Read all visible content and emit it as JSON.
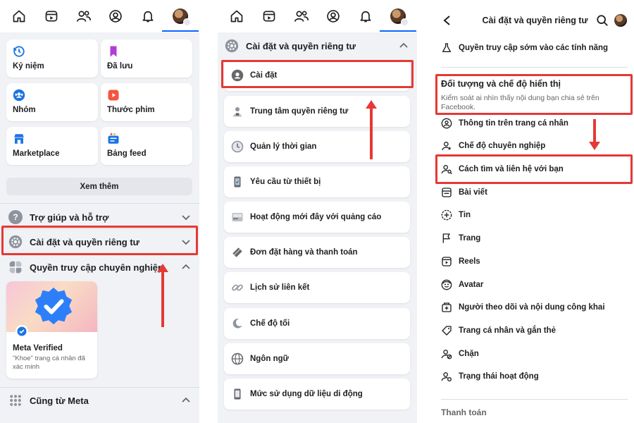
{
  "nav_tabs": [
    "home-icon",
    "video-icon",
    "friends-icon",
    "profile-icon",
    "bell-icon",
    "avatar-menu"
  ],
  "panel1": {
    "shortcuts": [
      {
        "label": "Kỷ niệm",
        "icon": "memories-icon"
      },
      {
        "label": "Đã lưu",
        "icon": "saved-icon"
      },
      {
        "label": "Nhóm",
        "icon": "groups-icon"
      },
      {
        "label": "Thước phim",
        "icon": "reels-icon"
      },
      {
        "label": "Marketplace",
        "icon": "marketplace-icon"
      },
      {
        "label": "Bảng feed",
        "icon": "feeds-icon"
      }
    ],
    "see_more": "Xem thêm",
    "help": "Trợ giúp và hỗ trợ",
    "settings_privacy": "Cài đặt và quyền riêng tư",
    "pro_access": "Quyền truy cập chuyên nghiệp",
    "promo_title": "Meta Verified",
    "promo_sub": "\"Khoe\" trang cá nhân đã xác minh",
    "also_from_meta": "Cũng từ Meta"
  },
  "panel2": {
    "header": "Cài đặt và quyền riêng tư",
    "items": [
      {
        "label": "Cài đặt",
        "icon": "settings-user-icon"
      },
      {
        "label": "Trung tâm quyền riêng tư",
        "icon": "privacy-center-icon"
      },
      {
        "label": "Quản lý thời gian",
        "icon": "clock-icon"
      },
      {
        "label": "Yêu cầu từ thiết bị",
        "icon": "device-icon"
      },
      {
        "label": "Hoạt động mới đây với quảng cáo",
        "icon": "ads-activity-icon"
      },
      {
        "label": "Đơn đặt hàng và thanh toán",
        "icon": "payment-icon"
      },
      {
        "label": "Lịch sử liên kết",
        "icon": "link-icon"
      },
      {
        "label": "Chế độ tối",
        "icon": "moon-icon"
      },
      {
        "label": "Ngôn ngữ",
        "icon": "globe-icon"
      },
      {
        "label": "Mức sử dụng dữ liệu di động",
        "icon": "phone-icon"
      }
    ]
  },
  "panel3": {
    "title": "Cài đặt và quyền riêng tư",
    "early_access": "Quyền truy cập sớm vào các tính năng",
    "section_title": "Đối tượng và chế độ hiển thị",
    "section_desc": "Kiểm soát ai nhìn thấy nội dung bạn chia sẻ trên Facebook.",
    "items": [
      {
        "label": "Thông tin trên trang cá nhân",
        "icon": "profile-info-icon"
      },
      {
        "label": "Chế độ chuyên nghiệp",
        "icon": "professional-icon"
      },
      {
        "label": "Cách tìm và liên hệ với bạn",
        "icon": "find-contact-icon"
      },
      {
        "label": "Bài viết",
        "icon": "posts-icon"
      },
      {
        "label": "Tin",
        "icon": "stories-icon"
      },
      {
        "label": "Trang",
        "icon": "flag-icon"
      },
      {
        "label": "Reels",
        "icon": "reels-icon"
      },
      {
        "label": "Avatar",
        "icon": "avatar-icon"
      },
      {
        "label": "Người theo dõi và nội dung công khai",
        "icon": "followers-icon"
      },
      {
        "label": "Trang cá nhân và gắn thẻ",
        "icon": "tag-icon"
      },
      {
        "label": "Chặn",
        "icon": "block-icon"
      },
      {
        "label": "Trạng thái hoạt động",
        "icon": "active-status-icon"
      }
    ],
    "cut_text": "Thanh toán"
  },
  "colors": {
    "highlight": "#e53935",
    "accent": "#0866ff",
    "bg": "#f0f2f5"
  }
}
